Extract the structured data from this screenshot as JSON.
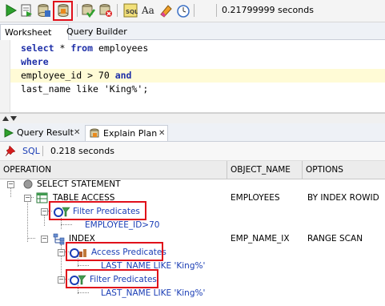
{
  "toolbar": {
    "icons": [
      "run-statement-icon",
      "run-script-icon",
      "autotrace-icon",
      "explain-plan-icon",
      "commit-icon",
      "rollback-icon",
      "sql-tuning-advisor-icon",
      "to-upper-lower-icon",
      "clear-icon",
      "history-icon"
    ],
    "elapsed": "0.21799999 seconds"
  },
  "top_tabs": {
    "worksheet": "Worksheet",
    "query_builder": "Query Builder"
  },
  "editor": {
    "lines": [
      {
        "kw1": "select",
        "mid": " * ",
        "kw2": "from",
        "rest": " employees"
      },
      {
        "kw1": "where",
        "mid": "",
        "kw2": "",
        "rest": ""
      },
      {
        "kw1": "",
        "mid": "employee_id > 70 ",
        "kw2": "and",
        "rest": ""
      },
      {
        "kw1": "",
        "mid": "last_name like 'King%';",
        "kw2": "",
        "rest": ""
      }
    ]
  },
  "bottom_tabs": {
    "query_result": "Query Result",
    "explain_plan": "Explain Plan"
  },
  "sql_bar": {
    "label": "SQL",
    "time": "0.218 seconds"
  },
  "plan": {
    "columns": [
      "OPERATION",
      "OBJECT_NAME",
      "OPTIONS"
    ],
    "rows": [
      {
        "operation": "SELECT STATEMENT",
        "object": "",
        "options": ""
      },
      {
        "operation": "TABLE ACCESS",
        "object": "EMPLOYEES",
        "options": "BY INDEX ROWID"
      },
      {
        "operation": "Filter Predicates",
        "object": "",
        "options": ""
      },
      {
        "operation": "EMPLOYEE_ID>70",
        "object": "",
        "options": ""
      },
      {
        "operation": "INDEX",
        "object": "EMP_NAME_IX",
        "options": "RANGE SCAN"
      },
      {
        "operation": "Access Predicates",
        "object": "",
        "options": ""
      },
      {
        "operation": "LAST_NAME LIKE 'King%'",
        "object": "",
        "options": ""
      },
      {
        "operation": "Filter Predicates",
        "object": "",
        "options": ""
      },
      {
        "operation": "LAST_NAME LIKE 'King%'",
        "object": "",
        "options": ""
      }
    ]
  },
  "colors": {
    "highlight_box": "#e0101a",
    "keyword": "#1e2fa8",
    "predicate_text": "#1a3db5"
  }
}
